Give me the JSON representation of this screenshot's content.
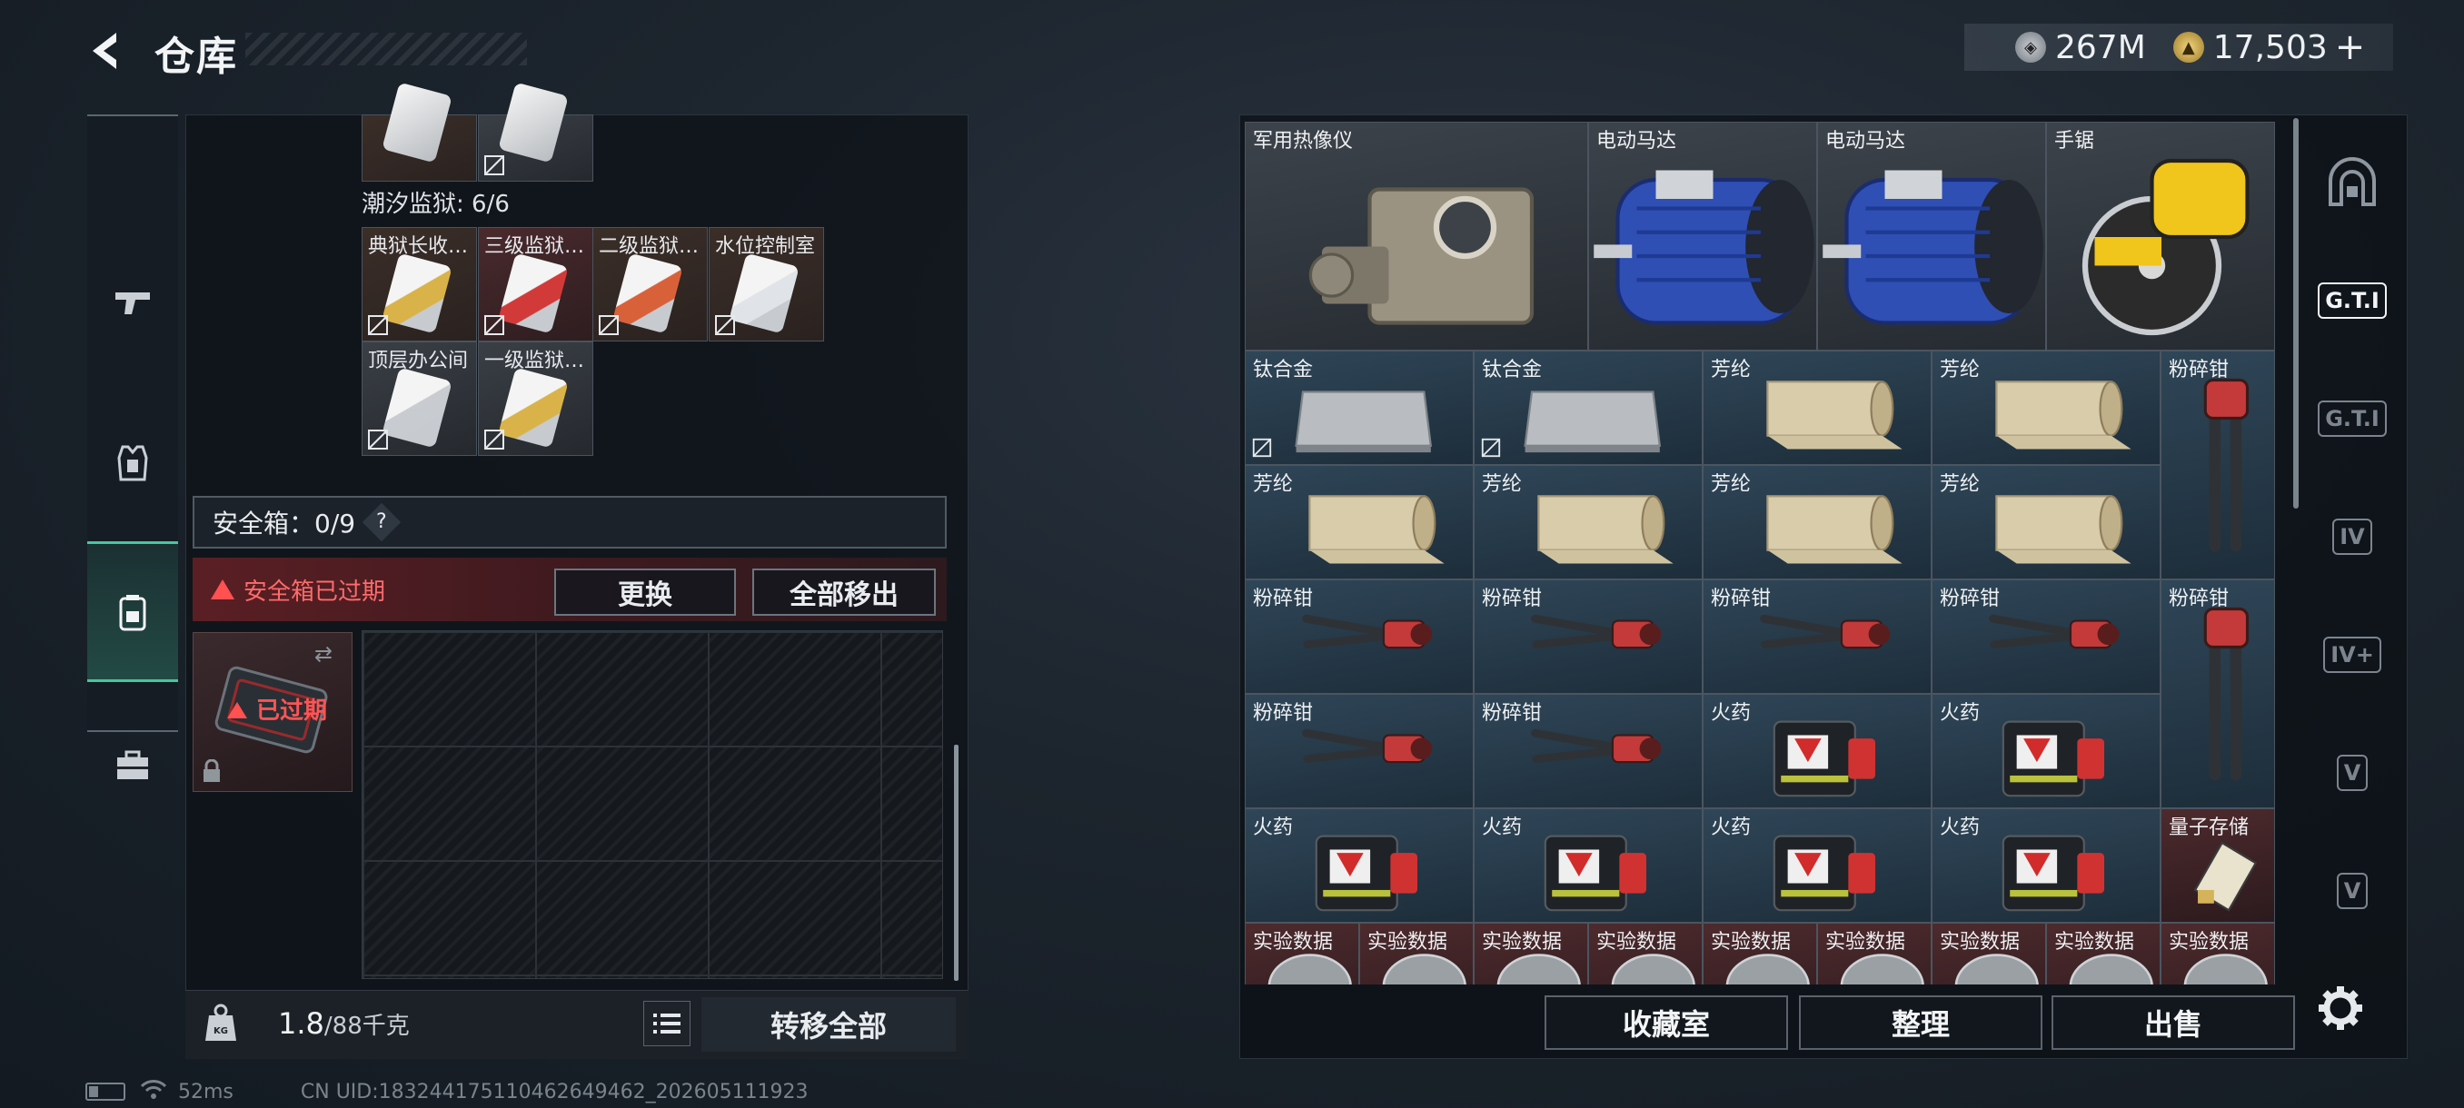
{
  "header": {
    "title": "仓库",
    "currency": {
      "silver": "267M",
      "gold": "17,503",
      "plus": "+"
    }
  },
  "left": {
    "prison_label": "潮汐监狱: 6/6",
    "cards": [
      {
        "label": "典狱长收…",
        "bg": "brown",
        "color": "#d9b34a"
      },
      {
        "label": "三级监狱…",
        "bg": "red",
        "color": "#d23a3a"
      },
      {
        "label": "二级监狱…",
        "bg": "brown",
        "color": "#d9613a"
      },
      {
        "label": "水位控制室",
        "bg": "brown",
        "color": "#e0e4e8"
      },
      {
        "label": "顶层办公间",
        "bg": "gray",
        "color": "#c8ccd0"
      },
      {
        "label": "一级监狱…",
        "bg": "gray",
        "color": "#d9b34a"
      }
    ],
    "safe_box_label": "安全箱：0/9",
    "safe_box_help": "?",
    "expired_text": "安全箱已过期",
    "replace_btn": "更换",
    "move_all_btn": "全部移出",
    "case_expired": "已过期",
    "weight_value": "1.8",
    "weight_max": "/88千克",
    "transfer_btn": "转移全部"
  },
  "inventory": {
    "items": [
      {
        "label": "军用热像仪",
        "bg": "gray",
        "art": "camera"
      },
      {
        "label": "电动马达",
        "bg": "gray",
        "art": "motor"
      },
      {
        "label": "电动马达",
        "bg": "gray",
        "art": "motor"
      },
      {
        "label": "手锯",
        "bg": "gray",
        "art": "saw"
      },
      {
        "label": "钛合金",
        "bg": "blue",
        "art": "plate",
        "nodrop": true
      },
      {
        "label": "钛合金",
        "bg": "blue",
        "art": "plate",
        "nodrop": true
      },
      {
        "label": "芳纶",
        "bg": "blue",
        "art": "roll"
      },
      {
        "label": "芳纶",
        "bg": "blue",
        "art": "roll"
      },
      {
        "label": "粉碎钳",
        "bg": "blue",
        "art": "cutter-v"
      },
      {
        "label": "芳纶",
        "bg": "blue",
        "art": "roll"
      },
      {
        "label": "芳纶",
        "bg": "blue",
        "art": "roll"
      },
      {
        "label": "芳纶",
        "bg": "blue",
        "art": "roll"
      },
      {
        "label": "芳纶",
        "bg": "blue",
        "art": "roll"
      },
      {
        "label": "粉碎钳",
        "bg": "blue",
        "art": "cutter-h"
      },
      {
        "label": "粉碎钳",
        "bg": "blue",
        "art": "cutter-h"
      },
      {
        "label": "粉碎钳",
        "bg": "blue",
        "art": "cutter-h"
      },
      {
        "label": "粉碎钳",
        "bg": "blue",
        "art": "cutter-h"
      },
      {
        "label": "粉碎钳",
        "bg": "blue",
        "art": "cutter-v"
      },
      {
        "label": "粉碎钳",
        "bg": "blue",
        "art": "cutter-h"
      },
      {
        "label": "粉碎钳",
        "bg": "blue",
        "art": "cutter-h"
      },
      {
        "label": "火药",
        "bg": "blue",
        "art": "powder"
      },
      {
        "label": "火药",
        "bg": "blue",
        "art": "powder"
      },
      {
        "label": "火药",
        "bg": "blue",
        "art": "powder"
      },
      {
        "label": "火药",
        "bg": "blue",
        "art": "powder"
      },
      {
        "label": "火药",
        "bg": "blue",
        "art": "powder"
      },
      {
        "label": "火药",
        "bg": "blue",
        "art": "powder"
      },
      {
        "label": "量子存储",
        "bg": "red",
        "art": "chip"
      },
      {
        "label": "实验数据",
        "bg": "red",
        "art": "disc"
      },
      {
        "label": "实验数据",
        "bg": "red",
        "art": "disc"
      },
      {
        "label": "实验数据",
        "bg": "red",
        "art": "disc"
      },
      {
        "label": "实验数据",
        "bg": "red",
        "art": "disc"
      },
      {
        "label": "实验数据",
        "bg": "red",
        "art": "disc"
      },
      {
        "label": "实验数据",
        "bg": "red",
        "art": "disc"
      },
      {
        "label": "实验数据",
        "bg": "red",
        "art": "disc"
      },
      {
        "label": "实验数据",
        "bg": "red",
        "art": "disc"
      },
      {
        "label": "实验数据",
        "bg": "red",
        "art": "disc"
      }
    ],
    "buttons": {
      "collection": "收藏室",
      "sort": "整理",
      "sell": "出售"
    }
  },
  "side_tabs": [
    "G.T.I",
    "G.T.I",
    "IV",
    "IV+",
    "V",
    "V"
  ],
  "status": {
    "ping": "52ms",
    "uid": "CN UID:183244175110462649462_202605111923"
  }
}
